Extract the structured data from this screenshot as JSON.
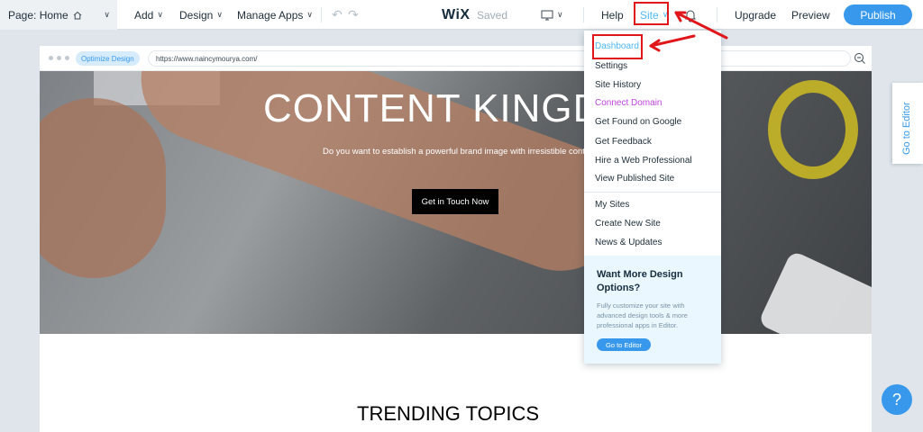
{
  "topbar": {
    "page_label": "Page: Home",
    "add": "Add",
    "design": "Design",
    "manage_apps": "Manage Apps",
    "logo": "WiX",
    "saved": "Saved",
    "help": "Help",
    "site": "Site",
    "upgrade": "Upgrade",
    "preview": "Preview",
    "publish": "Publish"
  },
  "browser": {
    "optimize": "Optimize Design",
    "url": "https://www.naincymourya.com/"
  },
  "hero": {
    "title": "CONTENT KINGD",
    "subtitle": "Do you want to establish a powerful brand image with irresistible content",
    "cta": "Get in Touch Now"
  },
  "section_title": "TRENDING TOPICS",
  "site_menu": {
    "items": [
      "Dashboard",
      "Settings",
      "Site History",
      "Connect Domain",
      "Get Found on Google",
      "Get Feedback",
      "Hire a Web Professional",
      "View Published Site",
      "My Sites",
      "Create New Site",
      "News & Updates"
    ],
    "promo_title": "Want More Design Options?",
    "promo_text": "Fully customize your site with advanced design tools & more professional apps in Editor.",
    "promo_button": "Go to Editor"
  },
  "side_tab": "Go to Editor",
  "help_button": "?",
  "colors": {
    "accent": "#3899ec",
    "site_link": "#4eb7f5",
    "connect_domain": "#c142e0",
    "annotation": "#e0161b"
  }
}
